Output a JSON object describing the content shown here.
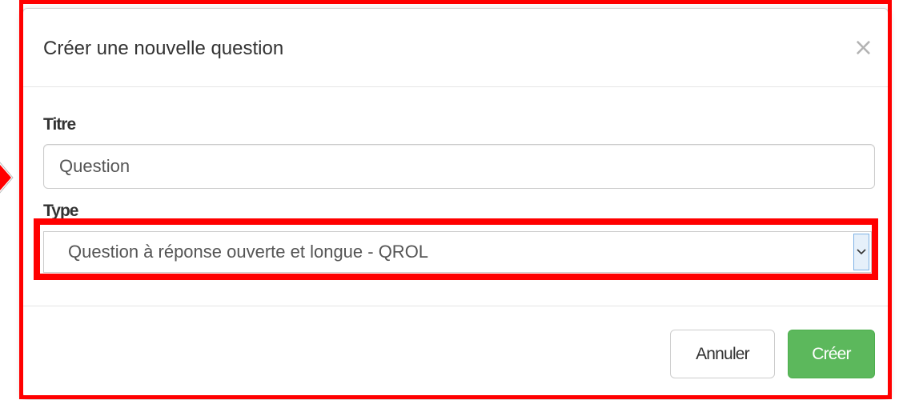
{
  "modal": {
    "title": "Créer une nouvelle question",
    "close_icon": "close-icon",
    "close_glyph": "×"
  },
  "form": {
    "title_label": "Titre",
    "title_value": "Question",
    "type_label": "Type",
    "type_selected": "Question à réponse ouverte et longue - QROL",
    "type_dropdown_icon": "chevron-down-icon"
  },
  "footer": {
    "cancel_label": "Annuler",
    "create_label": "Créer"
  },
  "colors": {
    "highlight": "#ff0000",
    "primary_success": "#5cb85c",
    "text": "#333333"
  }
}
